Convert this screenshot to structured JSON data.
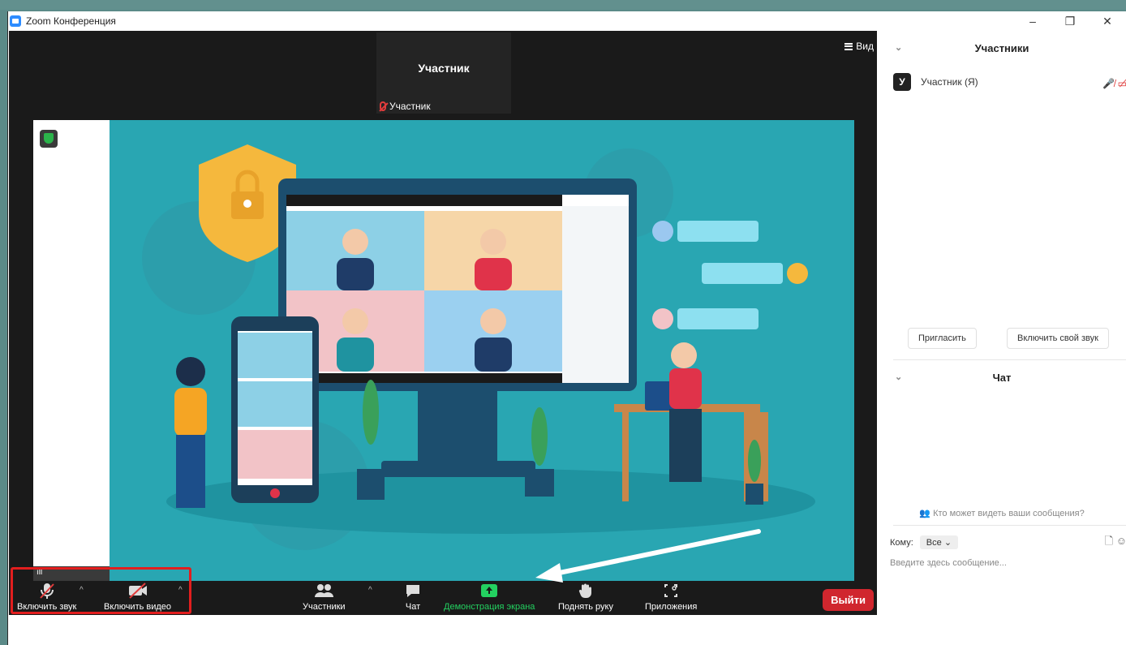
{
  "window": {
    "title": "Zoom Конференция"
  },
  "controls": {
    "minimize": "–",
    "restore": "❐",
    "close": "✕"
  },
  "stage": {
    "view_label": "Вид",
    "participant_tile": {
      "name": "Участник",
      "tag": "Участник"
    },
    "signal_label": "ıll"
  },
  "toolbar": {
    "unmute_label": "Включить звук",
    "video_label": "Включить видео",
    "participants_label": "Участники",
    "chat_label": "Чат",
    "share_label": "Демонстрация экрана",
    "raise_hand_label": "Поднять руку",
    "apps_label": "Приложения",
    "leave_label": "Выйти",
    "caret": "^"
  },
  "panel": {
    "participants_title": "Участники",
    "participant": {
      "initial": "У",
      "name": "Участник (Я)"
    },
    "participant_icons": "🎤̸ ▭̸",
    "invite_label": "Пригласить",
    "unmute_self_label": "Включить свой звук",
    "chat_title": "Чат",
    "who_can_see": "Кто может видеть ваши сообщения?",
    "to_label": "Кому:",
    "to_value": "Все",
    "message_placeholder": "Введите здесь сообщение...",
    "chevron": "⌄"
  },
  "colors": {
    "share_active": "#23d160",
    "leave_bg": "#d0262e",
    "accent": "#2d8cff",
    "highlight": "#e21e1e"
  }
}
